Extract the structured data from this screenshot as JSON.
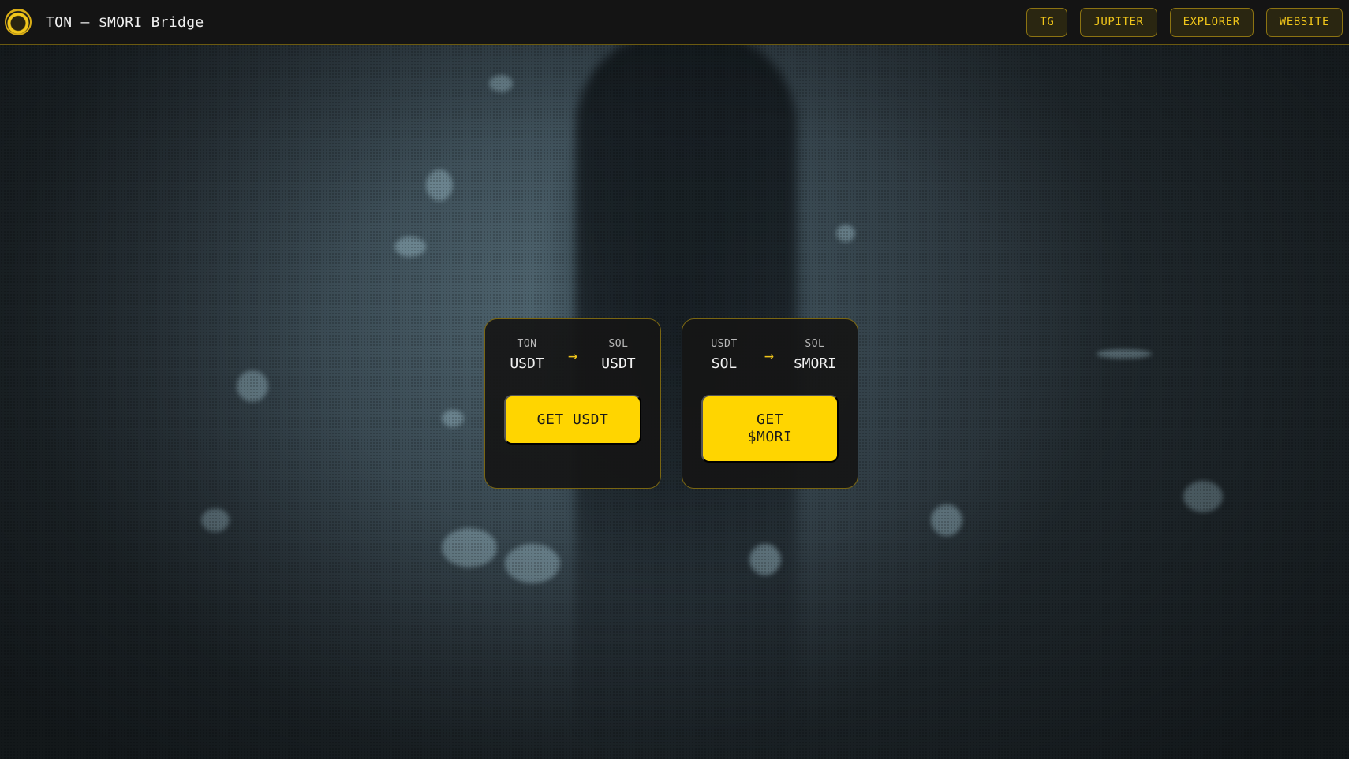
{
  "header": {
    "title": "TON – $MORI Bridge",
    "logo_icon": "mori-coin-logo-icon",
    "nav": [
      {
        "label": "TG"
      },
      {
        "label": "JUPITER"
      },
      {
        "label": "EXPLORER"
      },
      {
        "label": "WEBSITE"
      }
    ]
  },
  "cards": [
    {
      "from": {
        "chain": "TON",
        "symbol": "USDT"
      },
      "to": {
        "chain": "SOL",
        "symbol": "USDT"
      },
      "arrow_icon": "arrow-right-icon",
      "button_label": "GET USDT"
    },
    {
      "from": {
        "chain": "USDT",
        "symbol": "SOL"
      },
      "to": {
        "chain": "SOL",
        "symbol": "$MORI"
      },
      "arrow_icon": "arrow-right-icon",
      "button_label": "GET\n$MORI"
    }
  ],
  "colors": {
    "accent": "#ffd500",
    "header_bg": "#141414",
    "card_bg": "#161616",
    "border": "#7a6612"
  }
}
